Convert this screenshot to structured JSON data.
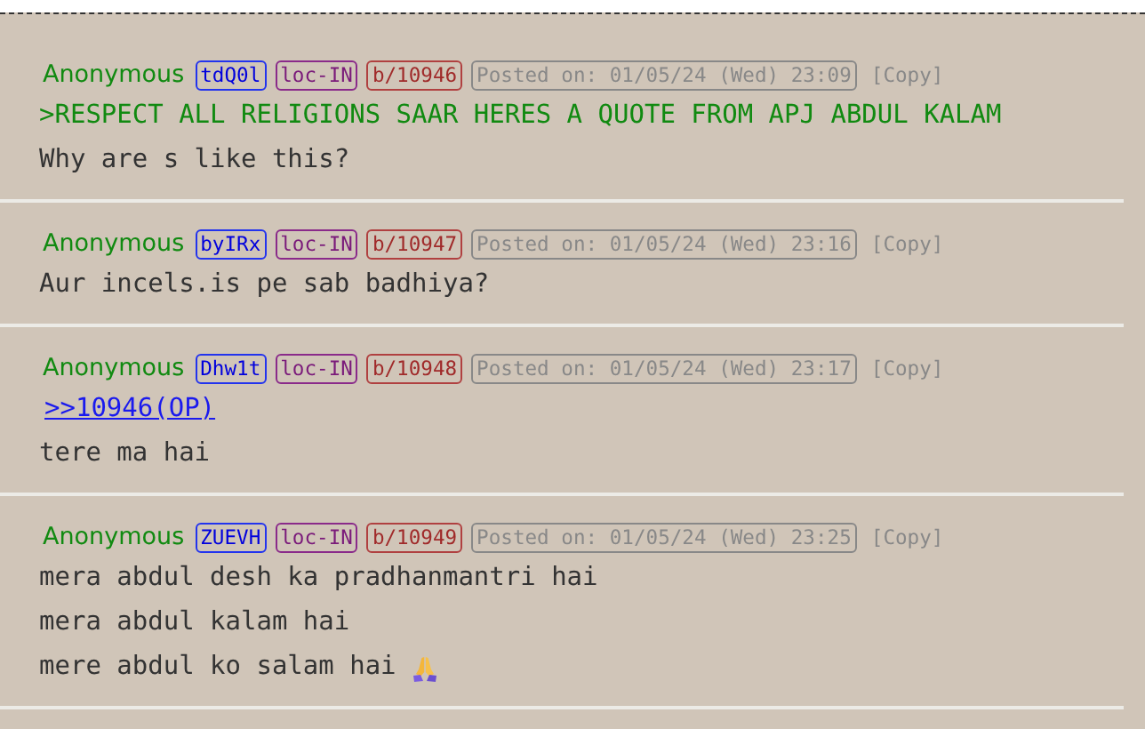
{
  "posts": [
    {
      "name": "Anonymous",
      "id": "tdQ0l",
      "loc": "loc-IN",
      "board": "b/10946",
      "posted": "Posted on: 01/05/24 (Wed) 23:09",
      "copy": "[Copy]",
      "lines": [
        {
          "kind": "quote",
          "text": ">RESPECT ALL RELIGIONS SAAR HERES A QUOTE FROM APJ ABDUL KALAM"
        },
        {
          "kind": "text",
          "text": "Why are s like this?"
        }
      ]
    },
    {
      "name": "Anonymous",
      "id": "byIRx",
      "loc": "loc-IN",
      "board": "b/10947",
      "posted": "Posted on: 01/05/24 (Wed) 23:16",
      "copy": "[Copy]",
      "lines": [
        {
          "kind": "text",
          "text": "Aur incels.is pe sab badhiya?"
        }
      ]
    },
    {
      "name": "Anonymous",
      "id": "Dhw1t",
      "loc": "loc-IN",
      "board": "b/10948",
      "posted": "Posted on: 01/05/24 (Wed) 23:17",
      "copy": "[Copy]",
      "lines": [
        {
          "kind": "link",
          "text": ">>10946(OP)"
        },
        {
          "kind": "text",
          "text": "tere ma hai"
        }
      ]
    },
    {
      "name": "Anonymous",
      "id": "ZUEVH",
      "loc": "loc-IN",
      "board": "b/10949",
      "posted": "Posted on: 01/05/24 (Wed) 23:25",
      "copy": "[Copy]",
      "lines": [
        {
          "kind": "text",
          "text": "mera abdul desh ka pradhanmantri hai"
        },
        {
          "kind": "text",
          "text": "mera abdul kalam hai"
        },
        {
          "kind": "text-with-emoji",
          "text": "mere abdul ko salam hai"
        }
      ]
    }
  ]
}
